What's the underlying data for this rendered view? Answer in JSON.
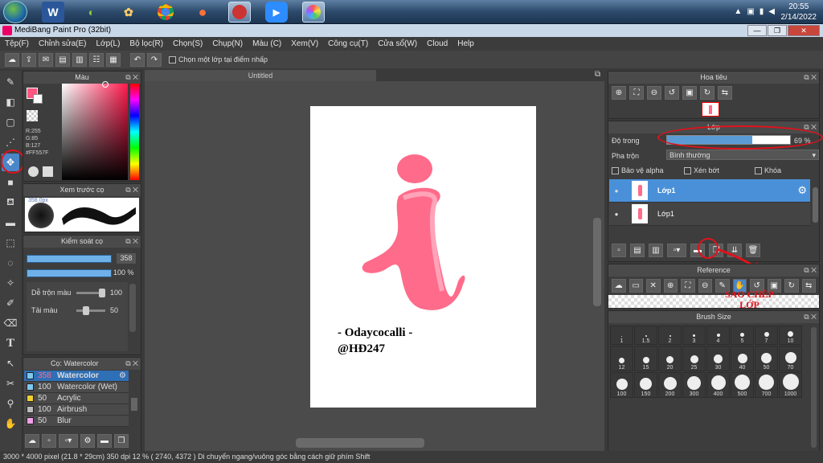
{
  "taskbar": {
    "time": "20:55",
    "date": "2/14/2022"
  },
  "app": {
    "title": "MediBang Paint Pro (32bit)"
  },
  "menu": [
    "Tệp(F)",
    "Chỉnh sửa(E)",
    "Lớp(L)",
    "Bộ lọc(R)",
    "Chọn(S)",
    "Chụp(N)",
    "Màu (C)",
    "Xem(V)",
    "Công cụ(T)",
    "Cửa sổ(W)",
    "Cloud",
    "Help"
  ],
  "toolbar": {
    "checkbox_label": "Chọn một lớp tại điểm nhấp"
  },
  "color_panel": {
    "title": "Màu",
    "r": "R:255",
    "g": "G:85",
    "b": "B:127",
    "hex": "#FF557F",
    "fg_color": "#FF557F"
  },
  "brush_preview": {
    "title": "Xem trước cọ",
    "size_label": "358.0px"
  },
  "brush_control": {
    "title": "Kiểm soát cọ",
    "size_value": "358",
    "opacity_value": "100 %",
    "blend_label": "Dễ trộn màu",
    "blend_value": "100",
    "ink_label": "Tải màu",
    "ink_value": "50"
  },
  "brush_list": {
    "title": "Cọ: Watercolor",
    "items": [
      {
        "size": "358",
        "name": "Watercolor",
        "color": "#7ec8f0",
        "selected": true
      },
      {
        "size": "100",
        "name": "Watercolor (Wet)",
        "color": "#7ec8f0",
        "selected": false
      },
      {
        "size": "50",
        "name": "Acrylic",
        "color": "#f0d030",
        "selected": false
      },
      {
        "size": "100",
        "name": "Airbrush",
        "color": "#bbbbbb",
        "selected": false
      },
      {
        "size": "50",
        "name": "Blur",
        "color": "#f0a0e8",
        "selected": false
      }
    ]
  },
  "canvas": {
    "tab_title": "Untitled",
    "watermark_line1": "- Odaycocalli -",
    "watermark_line2": "@HĐ247"
  },
  "navigator": {
    "title": "Hoa tiêu"
  },
  "layer_panel": {
    "title": "Lớp",
    "opacity_label": "Độ trong",
    "opacity_value": "69 %",
    "opacity_fraction": 0.69,
    "blend_label": "Pha trộn",
    "blend_value": "Bình thường",
    "protect_alpha": "Bảo vệ alpha",
    "clipping": "Xén bớt",
    "lock": "Khóa",
    "layers": [
      {
        "name": "Lớp1",
        "selected": true
      },
      {
        "name": "Lớp1",
        "selected": false
      }
    ]
  },
  "reference": {
    "title": "Reference",
    "annotation_line1": "SAO CHÉP",
    "annotation_line2": "LỚP"
  },
  "brush_size": {
    "title": "Brush Size",
    "sizes": [
      "1",
      "1.5",
      "2",
      "3",
      "4",
      "5",
      "7",
      "10",
      "12",
      "15",
      "20",
      "25",
      "30",
      "40",
      "50",
      "70",
      "100",
      "150",
      "200",
      "300",
      "400",
      "500",
      "700",
      "1000"
    ]
  },
  "status": {
    "text": "3000 * 4000 pixel   (21.8 * 29cm)   350 dpi   12 %   ( 2740, 4372 )   Di chuyển ngang/vuông góc bằng cách giữ phím Shift"
  }
}
